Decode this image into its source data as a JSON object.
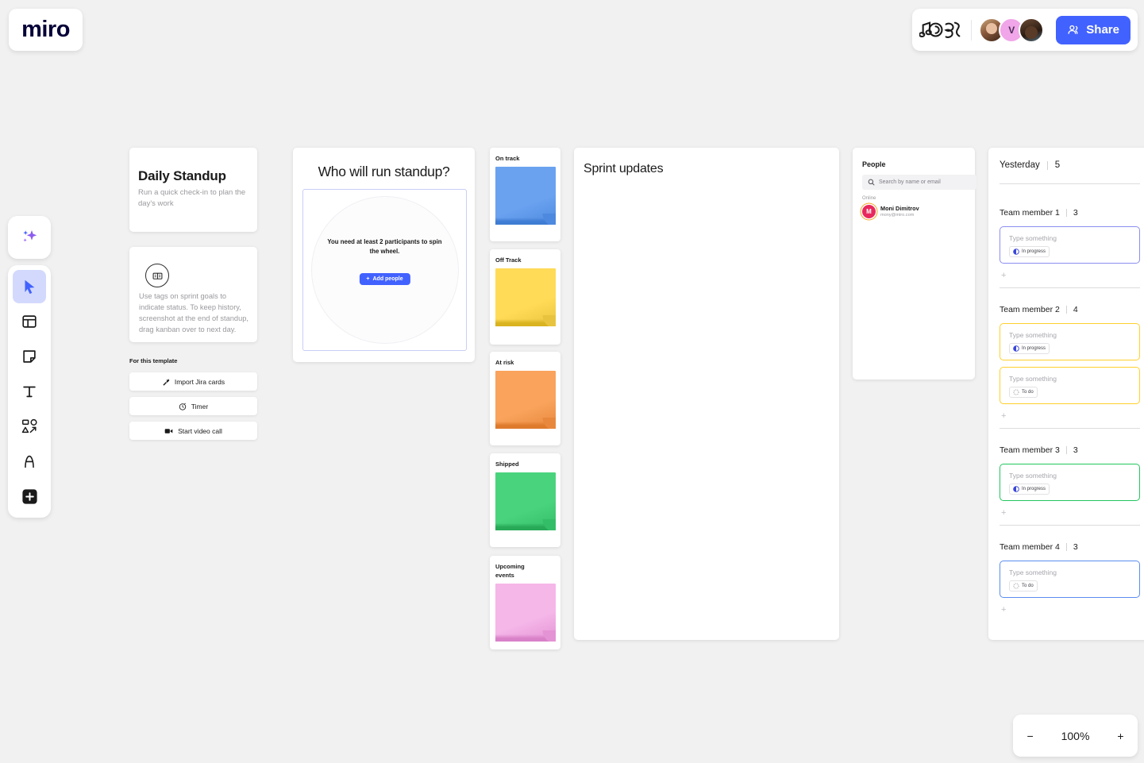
{
  "app": {
    "logo_text": "miro"
  },
  "topbar": {
    "squiggle_icon": "music-doodle-icon",
    "avatars": [
      {
        "name": "collaborator-1",
        "initial": ""
      },
      {
        "name": "collaborator-2",
        "initial": "V"
      },
      {
        "name": "collaborator-3",
        "initial": ""
      }
    ],
    "share_label": "Share",
    "share_icon": "people-icon",
    "share_color": "#4262ff"
  },
  "toolbar": {
    "items": [
      {
        "name": "ai-sparkle-icon",
        "label": "AI"
      },
      {
        "name": "cursor-select-icon",
        "label": "Select",
        "active": true
      },
      {
        "name": "templates-icon",
        "label": "Templates"
      },
      {
        "name": "sticky-note-icon",
        "label": "Sticky note"
      },
      {
        "name": "text-icon",
        "label": "Text"
      },
      {
        "name": "shapes-icon",
        "label": "Shapes and connectors"
      },
      {
        "name": "pen-icon",
        "label": "Pen"
      },
      {
        "name": "more-apps-icon",
        "label": "More apps"
      }
    ]
  },
  "standup": {
    "title": "Daily Standup",
    "subtitle": "Run a quick check-in to plan the day's work",
    "tip_icon": "tag-card-icon",
    "tip_text": "Use tags on sprint goals to indicate status. To keep history, screenshot at the end of standup, drag kanban over to next day.",
    "for_template_label": "For this template",
    "buttons": [
      {
        "label": "Import Jira cards",
        "icon": "jira-icon"
      },
      {
        "label": "Timer",
        "icon": "timer-icon"
      },
      {
        "label": "Start video call",
        "icon": "video-icon"
      }
    ]
  },
  "spinner": {
    "title": "Who will run standup?",
    "message": "You need at least 2 participants to spin the wheel.",
    "add_people_label": "Add people",
    "add_people_icon": "plus-icon"
  },
  "stickies": [
    {
      "label": "On track",
      "color": "#6aa2f0",
      "fold": "#4d89de",
      "bar": "#3f7cd4"
    },
    {
      "label": "Off Track",
      "color": "#ffdb57",
      "fold": "#e8c43e",
      "bar": "#d9b320"
    },
    {
      "label": "At risk",
      "color": "#f9a35c",
      "fold": "#e8883c",
      "bar": "#de7a2c"
    },
    {
      "label": "Shipped",
      "color": "#4ad37d",
      "fold": "#34bd67",
      "bar": "#27a957"
    },
    {
      "label": "Upcoming events",
      "color": "#f5b6e8",
      "fold": "#e493d4",
      "bar": "#d981c8"
    }
  ],
  "sprint": {
    "title": "Sprint updates"
  },
  "people": {
    "title": "People",
    "search_placeholder": "Search by name or email",
    "search_icon": "search-icon",
    "section_label": "Online",
    "person": {
      "initial": "M",
      "name": "Moni Dimitrov",
      "email": "mony@miro.com"
    }
  },
  "kanban": {
    "day_label": "Yesterday",
    "day_count": "5",
    "placeholder": "Type something",
    "plus_label": "+",
    "members": [
      {
        "name": "Team member 1",
        "count": "3",
        "border": "#8b8ef0",
        "notes": [
          {
            "status": "In progress",
            "status_icon": "half-circle-icon"
          }
        ]
      },
      {
        "name": "Team member 2",
        "count": "4",
        "border": "#ffd02e",
        "notes": [
          {
            "status": "In progress",
            "status_icon": "half-circle-icon"
          },
          {
            "status": "To do",
            "status_icon": "dotted-circle-icon"
          }
        ]
      },
      {
        "name": "Team member 3",
        "count": "3",
        "border": "#22c55e",
        "notes": [
          {
            "status": "In progress",
            "status_icon": "half-circle-icon"
          }
        ]
      },
      {
        "name": "Team member 4",
        "count": "3",
        "border": "#5b8def",
        "notes": [
          {
            "status": "To do",
            "status_icon": "dotted-circle-icon"
          }
        ]
      }
    ]
  },
  "zoom_control": {
    "minus": "−",
    "level": "100%",
    "plus": "+"
  }
}
